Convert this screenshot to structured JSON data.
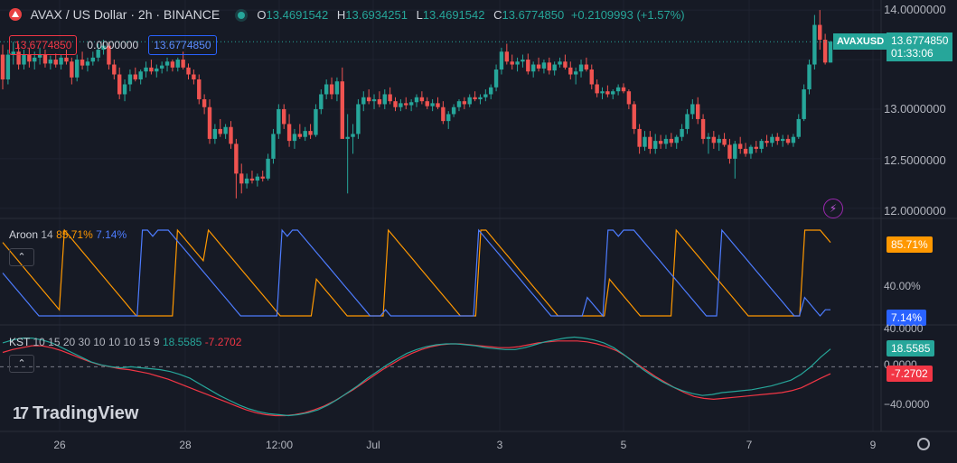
{
  "header": {
    "symbol": "AVAX / US Dollar · 2h · BINANCE",
    "o_label": "O",
    "o_value": "13.4691542",
    "h_label": "H",
    "h_value": "13.6934251",
    "l_label": "L",
    "l_value": "13.4691542",
    "c_label": "C",
    "c_value": "13.6774850",
    "change": "+0.2109993 (+1.57%)"
  },
  "trade": {
    "sell": "13.6774850",
    "spread": "0.0000000",
    "buy": "13.6774850"
  },
  "price_tag": {
    "symbol": "AVAXUSD",
    "last": "13.6774850",
    "countdown": "01:33:06"
  },
  "price_axis": [
    "14.0000000",
    "13.0000000",
    "12.5000000",
    "12.0000000"
  ],
  "aroon": {
    "name": "Aroon",
    "length": "14",
    "up": "85.71%",
    "down": "7.14%",
    "axis": "40.00%",
    "up_tag": "85.71%",
    "down_tag": "7.14%"
  },
  "kst": {
    "name": "KST",
    "params": "10 15 20 30 10 10 10 15 9",
    "kst_value": "18.5585",
    "signal_value": "-7.2702",
    "axis": [
      "40.0000",
      "0.0000",
      "−40.0000"
    ],
    "kst_tag": "18.5585",
    "signal_tag": "-7.2702"
  },
  "time_axis": [
    "26",
    "28",
    "12:00",
    "Jul",
    "3",
    "5",
    "7",
    "9"
  ],
  "brand": "TradingView",
  "colors": {
    "up": "#26a69a",
    "down": "#ef5350",
    "aroon_up": "#ff9800",
    "aroon_down": "#4d7cff",
    "kst": "#26a69a",
    "signal": "#f23645",
    "background": "#161a25"
  },
  "icons": {
    "collapse": "chevron-up-icon",
    "alert": "flash-icon",
    "settings": "gear-icon"
  },
  "chart_data": {
    "type": "candlestick",
    "ylim": [
      11.98,
      14.01
    ],
    "candles": [
      [
        13.55,
        13.65,
        13.2,
        13.3
      ],
      [
        13.3,
        13.6,
        13.25,
        13.55
      ],
      [
        13.55,
        13.68,
        13.45,
        13.58
      ],
      [
        13.58,
        13.66,
        13.4,
        13.45
      ],
      [
        13.45,
        13.6,
        13.4,
        13.55
      ],
      [
        13.55,
        13.62,
        13.42,
        13.48
      ],
      [
        13.48,
        13.58,
        13.4,
        13.52
      ],
      [
        13.52,
        13.62,
        13.45,
        13.55
      ],
      [
        13.55,
        13.6,
        13.42,
        13.46
      ],
      [
        13.46,
        13.54,
        13.4,
        13.5
      ],
      [
        13.5,
        13.56,
        13.42,
        13.45
      ],
      [
        13.45,
        13.55,
        13.4,
        13.52
      ],
      [
        13.52,
        13.6,
        13.45,
        13.48
      ],
      [
        13.48,
        13.52,
        13.25,
        13.32
      ],
      [
        13.32,
        13.55,
        13.28,
        13.5
      ],
      [
        13.5,
        13.58,
        13.4,
        13.44
      ],
      [
        13.44,
        13.52,
        13.38,
        13.48
      ],
      [
        13.48,
        13.58,
        13.44,
        13.52
      ],
      [
        13.52,
        13.66,
        13.48,
        13.6
      ],
      [
        13.6,
        13.7,
        13.55,
        13.64
      ],
      [
        13.64,
        13.68,
        13.4,
        13.45
      ],
      [
        13.45,
        13.5,
        13.3,
        13.35
      ],
      [
        13.35,
        13.42,
        13.1,
        13.15
      ],
      [
        13.15,
        13.3,
        13.08,
        13.25
      ],
      [
        13.25,
        13.4,
        13.18,
        13.35
      ],
      [
        13.35,
        13.42,
        13.28,
        13.3
      ],
      [
        13.3,
        13.4,
        13.25,
        13.38
      ],
      [
        13.38,
        13.48,
        13.32,
        13.42
      ],
      [
        13.42,
        13.5,
        13.35,
        13.38
      ],
      [
        13.38,
        13.45,
        13.32,
        13.41
      ],
      [
        13.41,
        13.48,
        13.36,
        13.44
      ],
      [
        13.44,
        13.52,
        13.38,
        13.48
      ],
      [
        13.48,
        13.5,
        13.38,
        13.42
      ],
      [
        13.42,
        13.52,
        13.38,
        13.5
      ],
      [
        13.5,
        13.58,
        13.4,
        13.42
      ],
      [
        13.42,
        13.46,
        13.3,
        13.35
      ],
      [
        13.35,
        13.4,
        13.25,
        13.3
      ],
      [
        13.3,
        13.35,
        13.05,
        13.1
      ],
      [
        13.1,
        13.15,
        12.95,
        13.02
      ],
      [
        13.02,
        13.1,
        12.65,
        12.7
      ],
      [
        12.7,
        12.85,
        12.65,
        12.8
      ],
      [
        12.8,
        12.9,
        12.72,
        12.75
      ],
      [
        12.75,
        12.85,
        12.7,
        12.82
      ],
      [
        12.82,
        12.88,
        12.6,
        12.65
      ],
      [
        12.65,
        12.7,
        12.1,
        12.35
      ],
      [
        12.35,
        12.45,
        12.15,
        12.25
      ],
      [
        12.25,
        12.35,
        12.2,
        12.3
      ],
      [
        12.3,
        12.38,
        12.25,
        12.28
      ],
      [
        12.28,
        12.35,
        12.22,
        12.32
      ],
      [
        12.32,
        12.38,
        12.27,
        12.3
      ],
      [
        12.3,
        12.55,
        12.28,
        12.5
      ],
      [
        12.5,
        12.8,
        12.45,
        12.75
      ],
      [
        12.75,
        13.05,
        12.7,
        13.0
      ],
      [
        13.0,
        13.05,
        12.8,
        12.85
      ],
      [
        12.85,
        12.95,
        12.62,
        12.68
      ],
      [
        12.68,
        12.8,
        12.6,
        12.75
      ],
      [
        12.75,
        12.85,
        12.7,
        12.72
      ],
      [
        12.72,
        12.82,
        12.68,
        12.78
      ],
      [
        12.78,
        12.85,
        12.7,
        12.74
      ],
      [
        12.74,
        13.05,
        12.72,
        13.0
      ],
      [
        13.0,
        13.2,
        12.95,
        13.15
      ],
      [
        13.15,
        13.3,
        13.1,
        13.25
      ],
      [
        13.25,
        13.32,
        13.1,
        13.15
      ],
      [
        13.15,
        13.32,
        13.08,
        13.28
      ],
      [
        13.28,
        13.42,
        12.9,
        12.7
      ],
      [
        12.7,
        12.95,
        12.15,
        12.72
      ],
      [
        12.72,
        12.85,
        12.55,
        12.75
      ],
      [
        12.75,
        13.1,
        12.7,
        13.05
      ],
      [
        13.05,
        13.18,
        12.98,
        13.12
      ],
      [
        13.12,
        13.2,
        13.05,
        13.08
      ],
      [
        13.08,
        13.15,
        13.0,
        13.1
      ],
      [
        13.1,
        13.18,
        13.02,
        13.05
      ],
      [
        13.05,
        13.2,
        13.0,
        13.15
      ],
      [
        13.15,
        13.22,
        13.05,
        13.08
      ],
      [
        13.08,
        13.12,
        12.98,
        13.02
      ],
      [
        13.02,
        13.1,
        12.98,
        13.06
      ],
      [
        13.06,
        13.12,
        13.0,
        13.04
      ],
      [
        13.04,
        13.1,
        12.98,
        13.07
      ],
      [
        13.07,
        13.15,
        13.02,
        13.12
      ],
      [
        13.12,
        13.18,
        13.05,
        13.08
      ],
      [
        13.08,
        13.12,
        13.0,
        13.03
      ],
      [
        13.03,
        13.1,
        12.98,
        13.06
      ],
      [
        13.06,
        13.12,
        13.0,
        13.02
      ],
      [
        13.02,
        13.08,
        12.85,
        12.88
      ],
      [
        12.88,
        12.98,
        12.8,
        12.95
      ],
      [
        12.95,
        13.05,
        12.92,
        13.02
      ],
      [
        13.02,
        13.1,
        12.98,
        13.08
      ],
      [
        13.08,
        13.12,
        13.0,
        13.05
      ],
      [
        13.05,
        13.15,
        13.02,
        13.12
      ],
      [
        13.12,
        13.18,
        13.08,
        13.1
      ],
      [
        13.1,
        13.15,
        13.05,
        13.12
      ],
      [
        13.12,
        13.2,
        13.08,
        13.15
      ],
      [
        13.15,
        13.25,
        13.1,
        13.22
      ],
      [
        13.22,
        13.45,
        13.18,
        13.4
      ],
      [
        13.4,
        13.62,
        13.35,
        13.58
      ],
      [
        13.58,
        13.66,
        13.45,
        13.48
      ],
      [
        13.48,
        13.55,
        13.4,
        13.45
      ],
      [
        13.45,
        13.52,
        13.38,
        13.48
      ],
      [
        13.48,
        13.55,
        13.42,
        13.5
      ],
      [
        13.5,
        13.56,
        13.35,
        13.38
      ],
      [
        13.38,
        13.48,
        13.32,
        13.45
      ],
      [
        13.45,
        13.52,
        13.38,
        13.41
      ],
      [
        13.41,
        13.5,
        13.36,
        13.47
      ],
      [
        13.47,
        13.52,
        13.35,
        13.39
      ],
      [
        13.39,
        13.48,
        13.34,
        13.45
      ],
      [
        13.45,
        13.52,
        13.42,
        13.48
      ],
      [
        13.48,
        13.55,
        13.4,
        13.42
      ],
      [
        13.42,
        13.48,
        13.3,
        13.35
      ],
      [
        13.35,
        13.42,
        13.25,
        13.38
      ],
      [
        13.38,
        13.5,
        13.32,
        13.45
      ],
      [
        13.45,
        13.52,
        13.38,
        13.4
      ],
      [
        13.4,
        13.45,
        13.2,
        13.25
      ],
      [
        13.25,
        13.3,
        13.12,
        13.16
      ],
      [
        13.16,
        13.22,
        13.1,
        13.18
      ],
      [
        13.18,
        13.24,
        13.12,
        13.15
      ],
      [
        13.15,
        13.2,
        13.1,
        13.18
      ],
      [
        13.18,
        13.25,
        13.14,
        13.22
      ],
      [
        13.22,
        13.26,
        13.16,
        13.18
      ],
      [
        13.18,
        13.2,
        13.0,
        13.05
      ],
      [
        13.05,
        13.08,
        12.75,
        12.8
      ],
      [
        12.8,
        12.85,
        12.55,
        12.62
      ],
      [
        12.62,
        12.78,
        12.58,
        12.72
      ],
      [
        12.72,
        12.78,
        12.55,
        12.6
      ],
      [
        12.6,
        12.75,
        12.55,
        12.68
      ],
      [
        12.68,
        12.74,
        12.6,
        12.65
      ],
      [
        12.65,
        12.74,
        12.6,
        12.7
      ],
      [
        12.7,
        12.76,
        12.62,
        12.66
      ],
      [
        12.66,
        12.74,
        12.6,
        12.72
      ],
      [
        12.72,
        12.85,
        12.68,
        12.8
      ],
      [
        12.8,
        13.0,
        12.75,
        12.95
      ],
      [
        12.95,
        13.1,
        12.9,
        13.05
      ],
      [
        13.05,
        13.12,
        12.85,
        12.9
      ],
      [
        12.9,
        12.95,
        12.65,
        12.7
      ],
      [
        12.7,
        12.76,
        12.55,
        12.72
      ],
      [
        12.72,
        12.78,
        12.6,
        12.66
      ],
      [
        12.66,
        12.74,
        12.58,
        12.7
      ],
      [
        12.7,
        12.76,
        12.62,
        12.64
      ],
      [
        12.64,
        12.7,
        12.45,
        12.5
      ],
      [
        12.5,
        12.68,
        12.3,
        12.65
      ],
      [
        12.65,
        12.72,
        12.55,
        12.6
      ],
      [
        12.6,
        12.66,
        12.52,
        12.55
      ],
      [
        12.55,
        12.64,
        12.5,
        12.62
      ],
      [
        12.62,
        12.68,
        12.56,
        12.6
      ],
      [
        12.6,
        12.7,
        12.56,
        12.68
      ],
      [
        12.68,
        12.74,
        12.62,
        12.66
      ],
      [
        12.66,
        12.75,
        12.62,
        12.72
      ],
      [
        12.72,
        12.76,
        12.64,
        12.68
      ],
      [
        12.68,
        12.74,
        12.62,
        12.7
      ],
      [
        12.7,
        12.74,
        12.64,
        12.66
      ],
      [
        12.66,
        12.75,
        12.62,
        12.72
      ],
      [
        12.72,
        12.95,
        12.7,
        12.9
      ],
      [
        12.9,
        13.25,
        12.88,
        13.2
      ],
      [
        13.2,
        13.5,
        13.15,
        13.45
      ],
      [
        13.45,
        13.95,
        13.4,
        13.85
      ],
      [
        13.85,
        14.0,
        13.6,
        13.7
      ],
      [
        13.7,
        13.76,
        13.45,
        13.47
      ],
      [
        13.47,
        13.69,
        13.47,
        13.68
      ]
    ],
    "aroon_up": [
      85.71,
      78.57,
      71.43,
      64.29,
      57.14,
      50,
      42.86,
      35.71,
      28.57,
      21.43,
      14.29,
      7.14,
      100,
      92.86,
      85.71,
      78.57,
      71.43,
      64.29,
      57.14,
      50,
      42.86,
      35.71,
      28.57,
      21.43,
      14.29,
      7.14,
      0,
      0,
      0,
      0,
      0,
      0,
      0,
      0,
      100,
      92.86,
      85.71,
      78.57,
      71.43,
      64.29,
      100,
      92.86,
      85.71,
      78.57,
      71.43,
      64.29,
      57.14,
      50,
      42.86,
      35.71,
      28.57,
      21.43,
      14.29,
      7.14,
      0,
      0,
      0,
      0,
      0,
      0,
      0,
      42.86,
      35.71,
      28.57,
      21.43,
      14.29,
      7.14,
      0,
      0,
      0,
      0,
      0,
      0,
      0,
      0,
      100,
      92.86,
      85.71,
      78.57,
      71.43,
      64.29,
      57.14,
      50,
      42.86,
      35.71,
      28.57,
      21.43,
      14.29,
      7.14,
      0,
      0,
      0,
      0,
      100,
      100,
      92.86,
      85.71,
      78.57,
      71.43,
      64.29,
      57.14,
      50,
      42.86,
      35.71,
      28.57,
      21.43,
      14.29,
      7.14,
      0,
      0,
      0,
      0,
      0,
      0,
      0,
      0,
      0,
      0,
      42.86,
      35.71,
      28.57,
      21.43,
      14.29,
      7.14,
      0,
      0,
      0,
      0,
      0,
      0,
      0,
      100,
      92.86,
      85.71,
      78.57,
      71.43,
      64.29,
      57.14,
      50,
      42.86,
      35.71,
      28.57,
      21.43,
      14.29,
      7.14,
      0,
      0,
      0,
      0,
      0,
      0,
      0,
      0,
      0,
      0,
      0,
      100,
      100,
      100,
      100,
      92.86,
      85.71
    ],
    "aroon_down": [
      50,
      42.86,
      35.71,
      28.57,
      21.43,
      14.29,
      7.14,
      0,
      0,
      0,
      0,
      0,
      0,
      0,
      0,
      0,
      0,
      0,
      0,
      0,
      0,
      0,
      0,
      0,
      0,
      0,
      0,
      100,
      100,
      92.86,
      100,
      100,
      100,
      92.86,
      85.71,
      78.57,
      71.43,
      64.29,
      57.14,
      50,
      42.86,
      35.71,
      28.57,
      21.43,
      14.29,
      7.14,
      0,
      0,
      0,
      0,
      0,
      0,
      0,
      0,
      100,
      92.86,
      100,
      100,
      92.86,
      85.71,
      78.57,
      71.43,
      64.29,
      57.14,
      50,
      42.86,
      35.71,
      28.57,
      21.43,
      14.29,
      7.14,
      0,
      0,
      0,
      7.14,
      0,
      0,
      0,
      0,
      0,
      0,
      0,
      0,
      0,
      0,
      0,
      0,
      0,
      0,
      0,
      0,
      0,
      100,
      92.86,
      85.71,
      78.57,
      71.43,
      64.29,
      57.14,
      50,
      42.86,
      35.71,
      28.57,
      21.43,
      14.29,
      7.14,
      0,
      0,
      0,
      0,
      0,
      0,
      0,
      21.43,
      14.29,
      7.14,
      0,
      100,
      100,
      92.86,
      100,
      100,
      100,
      92.86,
      85.71,
      78.57,
      71.43,
      64.29,
      57.14,
      50,
      42.86,
      35.71,
      28.57,
      21.43,
      14.29,
      7.14,
      0,
      0,
      0,
      100,
      92.86,
      85.71,
      78.57,
      71.43,
      64.29,
      57.14,
      50,
      42.86,
      35.71,
      28.57,
      21.43,
      14.29,
      7.14,
      0,
      0,
      21.43,
      14.29,
      7.14,
      0,
      7.14,
      7.14
    ],
    "kst": [
      25,
      28,
      30,
      30,
      28,
      25,
      20,
      15,
      10,
      5,
      2,
      0,
      -1,
      0,
      -1,
      -2,
      -3,
      -5,
      -8,
      -12,
      -18,
      -24,
      -30,
      -35,
      -40,
      -44,
      -47,
      -49,
      -50,
      -51,
      -50,
      -48,
      -45,
      -40,
      -34,
      -27,
      -20,
      -12,
      -5,
      2,
      8,
      14,
      18,
      21,
      23,
      24,
      24,
      23,
      22,
      20,
      19,
      18,
      18,
      20,
      23,
      26,
      28,
      30,
      31,
      30,
      28,
      25,
      20,
      13,
      5,
      -3,
      -10,
      -16,
      -21,
      -25,
      -28,
      -30,
      -29,
      -27,
      -26,
      -25,
      -24,
      -22,
      -20,
      -17,
      -14,
      -8,
      0,
      10,
      18.56
    ],
    "signal": [
      15,
      18,
      20,
      22,
      22,
      20,
      17,
      13,
      9,
      5,
      2,
      0,
      -2,
      -3,
      -5,
      -7,
      -10,
      -13,
      -17,
      -21,
      -25,
      -29,
      -33,
      -37,
      -41,
      -45,
      -48,
      -50,
      -51,
      -51,
      -50,
      -48,
      -45,
      -41,
      -36,
      -30,
      -24,
      -17,
      -10,
      -3,
      3,
      9,
      14,
      18,
      21,
      23,
      24,
      24,
      23,
      22,
      21,
      20,
      20,
      21,
      23,
      25,
      26,
      27,
      27,
      27,
      26,
      24,
      21,
      17,
      11,
      4,
      -3,
      -10,
      -16,
      -22,
      -27,
      -31,
      -33,
      -34,
      -33,
      -32,
      -31,
      -30,
      -29,
      -28,
      -27,
      -25,
      -22,
      -17,
      -12,
      -7.27
    ],
    "kst_ylim": [
      -60,
      40
    ],
    "time_labels": [
      "26",
      "28",
      "12:00",
      "Jul",
      "3",
      "5",
      "7",
      "9"
    ]
  }
}
